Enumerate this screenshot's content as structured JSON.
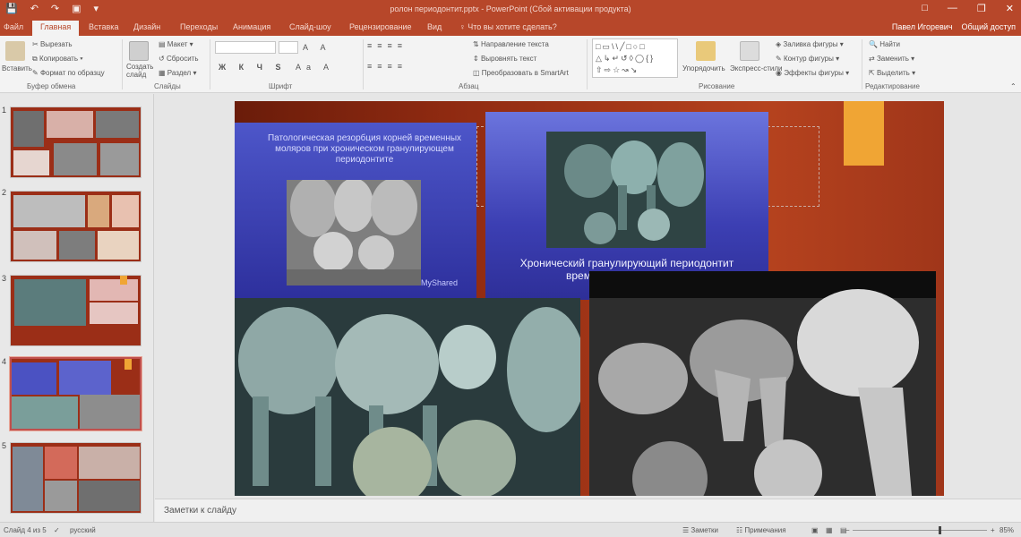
{
  "window": {
    "title": "ролон периодонтит.pptx - PowerPoint (Сбой активации продукта)",
    "qat_icons": [
      "save-icon",
      "undo-icon",
      "redo-icon",
      "slideshow-icon",
      "customize-icon"
    ]
  },
  "tabs": [
    {
      "label": "Файл"
    },
    {
      "label": "Главная"
    },
    {
      "label": "Вставка"
    },
    {
      "label": "Дизайн"
    },
    {
      "label": "Переходы"
    },
    {
      "label": "Анимация"
    },
    {
      "label": "Слайд-шоу"
    },
    {
      "label": "Рецензирование"
    },
    {
      "label": "Вид"
    }
  ],
  "tell_me": "♀ Что вы хотите сделать?",
  "user": {
    "name": "Павел Игоревич",
    "share": "Общий доступ"
  },
  "ribbon": {
    "clipboard": {
      "paste": "Вставить",
      "cut": "Вырезать",
      "copy": "Копировать",
      "format_painter": "Формат по образцу",
      "group": "Буфер обмена"
    },
    "slides": {
      "new_slide": "Создать слайд",
      "layout": "Макет",
      "reset": "Сбросить",
      "section": "Раздел",
      "group": "Слайды"
    },
    "font": {
      "group": "Шрифт"
    },
    "paragraph": {
      "text_direction": "Направление текста",
      "align_text": "Выровнять текст",
      "smartart": "Преобразовать в SmartArt",
      "group": "Абзац"
    },
    "drawing": {
      "arrange": "Упорядочить",
      "quick_styles": "Экспресс-стили",
      "fill": "Заливка фигуры",
      "outline": "Контур фигуры",
      "effects": "Эффекты фигуры",
      "group": "Рисование"
    },
    "editing": {
      "find": "Найти",
      "replace": "Заменить",
      "select": "Выделить",
      "group": "Редактирование"
    }
  },
  "thumbnails": [
    {
      "number": "1"
    },
    {
      "number": "2"
    },
    {
      "number": "3"
    },
    {
      "number": "4"
    },
    {
      "number": "5"
    }
  ],
  "slide": {
    "left_caption": "Патологическая резорбция корней временных моляров при хроническом гранулирующем периодонтите",
    "watermark": "MyShared",
    "right_caption": "Хронический гранулирующий периодонтит временны... кортикаль..."
  },
  "notes_placeholder": "Заметки к слайду",
  "status": {
    "slide_info": "Слайд 4 из 5",
    "language": "русский",
    "notes": "Заметки",
    "comments": "Примечания",
    "zoom": "85%"
  }
}
